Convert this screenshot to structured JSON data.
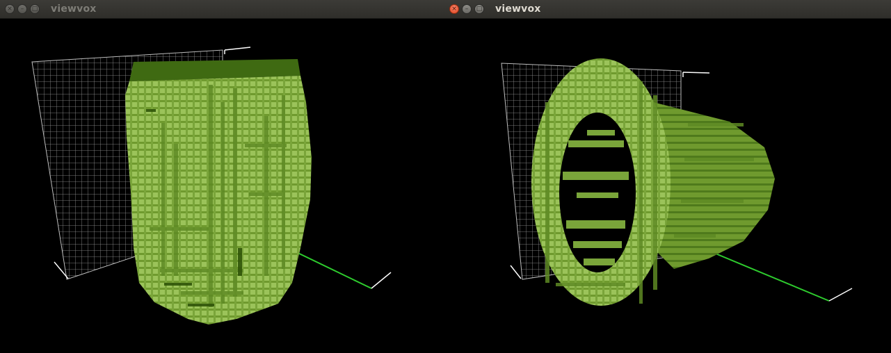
{
  "windows": [
    {
      "title": "viewvox",
      "active": false,
      "controls": [
        "close-icon",
        "minimize-icon",
        "maximize-icon"
      ],
      "model": "voxel-shape-upright"
    },
    {
      "title": "viewvox",
      "active": true,
      "controls": [
        "close-icon",
        "minimize-icon",
        "maximize-icon"
      ],
      "model": "voxel-shape-ring"
    }
  ],
  "colors": {
    "voxel_light": "#9bc35a",
    "voxel_mid": "#6f9a2e",
    "voxel_dark": "#3f6a12",
    "grid": "#9a9a9a",
    "axis_x": "#2ecc2e",
    "axis_white": "#ffffff",
    "titlebar": "#3c3b37"
  }
}
